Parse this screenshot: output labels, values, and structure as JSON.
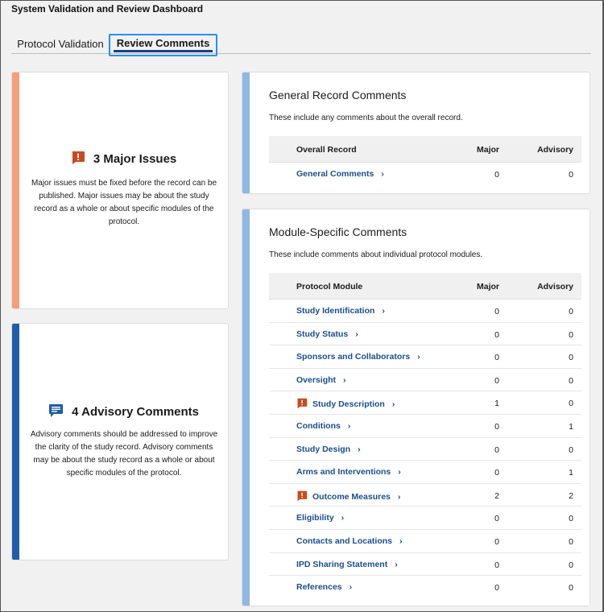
{
  "app": {
    "title": "System Validation and Review Dashboard"
  },
  "tabs": [
    {
      "label": "Protocol Validation",
      "active": false
    },
    {
      "label": "Review Comments",
      "active": true
    }
  ],
  "summary": {
    "major": {
      "title": "3 Major Issues",
      "body": "Major issues must be fixed before the record can be published. Major issues may be about the study record as a whole or about specific modules of the protocol.",
      "icon": "exclamation-icon",
      "color": "#c84a1e"
    },
    "advisory": {
      "title": "4 Advisory Comments",
      "body": "Advisory comments should be addressed to improve the clarity of the study record. Advisory comments may be about the study record as a whole or about specific modules of the protocol.",
      "icon": "comment-icon",
      "color": "#1f5da8"
    }
  },
  "general": {
    "title": "General Record Comments",
    "description": "These include any comments about the overall record.",
    "headers": {
      "name": "Overall Record",
      "major": "Major",
      "advisory": "Advisory"
    },
    "rows": [
      {
        "name": "General Comments",
        "major": "0",
        "advisory": "0",
        "warn": false
      }
    ]
  },
  "modules": {
    "title": "Module-Specific Comments",
    "description": "These include comments about individual protocol modules.",
    "headers": {
      "name": "Protocol Module",
      "major": "Major",
      "advisory": "Advisory"
    },
    "rows": [
      {
        "name": "Study Identification",
        "major": "0",
        "advisory": "0",
        "warn": false
      },
      {
        "name": "Study Status",
        "major": "0",
        "advisory": "0",
        "warn": false
      },
      {
        "name": "Sponsors and Collaborators",
        "major": "0",
        "advisory": "0",
        "warn": false
      },
      {
        "name": "Oversight",
        "major": "0",
        "advisory": "0",
        "warn": false
      },
      {
        "name": "Study Description",
        "major": "1",
        "advisory": "0",
        "warn": true
      },
      {
        "name": "Conditions",
        "major": "0",
        "advisory": "1",
        "warn": false
      },
      {
        "name": "Study Design",
        "major": "0",
        "advisory": "0",
        "warn": false
      },
      {
        "name": "Arms and Interventions",
        "major": "0",
        "advisory": "1",
        "warn": false
      },
      {
        "name": "Outcome Measures",
        "major": "2",
        "advisory": "2",
        "warn": true
      },
      {
        "name": "Eligibility",
        "major": "0",
        "advisory": "0",
        "warn": false
      },
      {
        "name": "Contacts and Locations",
        "major": "0",
        "advisory": "0",
        "warn": false
      },
      {
        "name": "IPD Sharing Statement",
        "major": "0",
        "advisory": "0",
        "warn": false
      },
      {
        "name": "References",
        "major": "0",
        "advisory": "0",
        "warn": false
      }
    ]
  },
  "icons": {
    "chevron": "chevron-right-icon",
    "warning": "exclamation-icon"
  },
  "colors": {
    "link": "#1a4e8c",
    "major_bar": "#f4a07a",
    "advisory_bar": "#1f5da8",
    "section_bar": "#8fb8e3",
    "tab_focus": "#2491ff"
  }
}
